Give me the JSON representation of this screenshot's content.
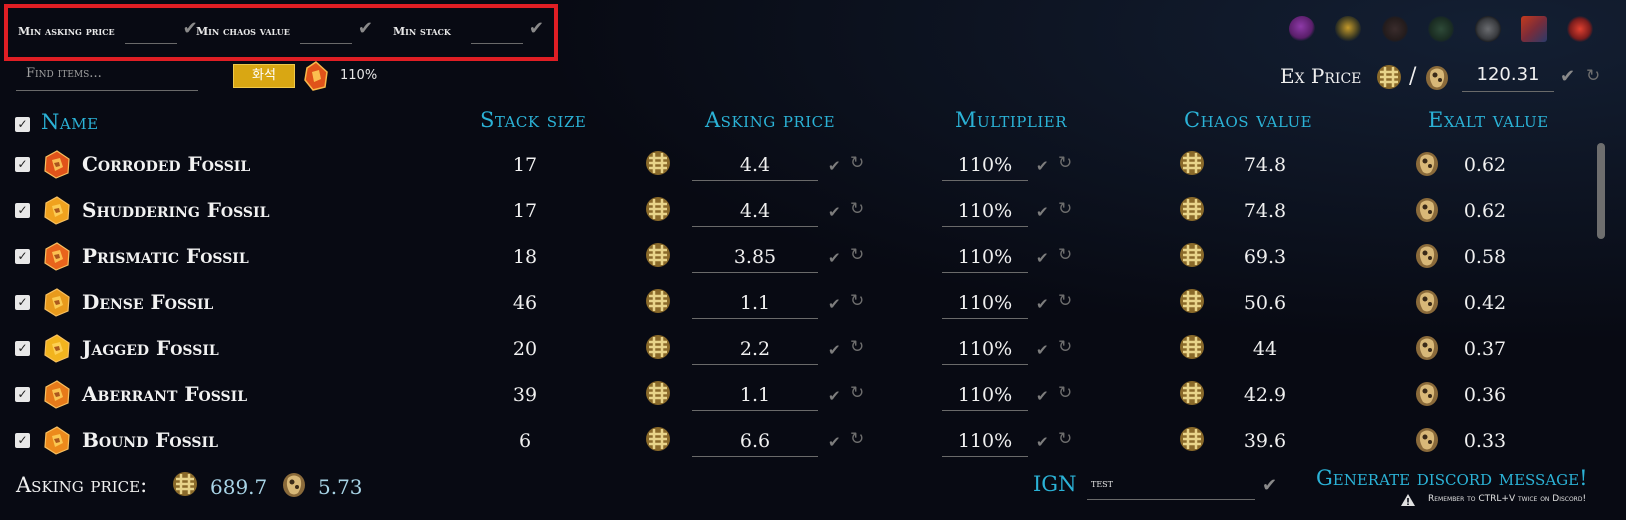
{
  "filters": {
    "min_asking_price": "Min asking price",
    "min_chaos_value": "Min chaos value",
    "min_stack": "Min stack"
  },
  "search": {
    "placeholder": "Find items..."
  },
  "language_button": "화석",
  "top_multiplier": "110%",
  "ex_price": {
    "label": "Ex Price",
    "separator": "/",
    "value": "120.31"
  },
  "table": {
    "headers": {
      "name": "Name",
      "stack_size": "Stack size",
      "asking_price": "Asking price",
      "multiplier": "Multiplier",
      "chaos_value": "Chaos value",
      "exalt_value": "Exalt value"
    },
    "rows": [
      {
        "name": "Corroded Fossil",
        "stack": "17",
        "asking": "4.4",
        "multiplier": "110%",
        "chaos": "74.8",
        "exalt": "0.62",
        "color": "#e0531a"
      },
      {
        "name": "Shuddering Fossil",
        "stack": "17",
        "asking": "4.4",
        "multiplier": "110%",
        "chaos": "74.8",
        "exalt": "0.62",
        "color": "#f0a21e"
      },
      {
        "name": "Prismatic Fossil",
        "stack": "18",
        "asking": "3.85",
        "multiplier": "110%",
        "chaos": "69.3",
        "exalt": "0.58",
        "color": "#e8641c"
      },
      {
        "name": "Dense Fossil",
        "stack": "46",
        "asking": "1.1",
        "multiplier": "110%",
        "chaos": "50.6",
        "exalt": "0.42",
        "color": "#e89a1c"
      },
      {
        "name": "Jagged Fossil",
        "stack": "20",
        "asking": "2.2",
        "multiplier": "110%",
        "chaos": "44",
        "exalt": "0.37",
        "color": "#f2b41e"
      },
      {
        "name": "Aberrant Fossil",
        "stack": "39",
        "asking": "1.1",
        "multiplier": "110%",
        "chaos": "42.9",
        "exalt": "0.36",
        "color": "#e67a1a"
      },
      {
        "name": "Bound Fossil",
        "stack": "6",
        "asking": "6.6",
        "multiplier": "110%",
        "chaos": "39.6",
        "exalt": "0.33",
        "color": "#ec8a1c"
      }
    ]
  },
  "footer": {
    "asking_price_label": "Asking price:",
    "total_chaos": "689.7",
    "total_exalt": "5.73",
    "ign_label": "IGN",
    "ign_value": "test",
    "generate_button": "Generate discord message!",
    "reminder": "Remember to CTRL+V twice on Discord!"
  },
  "icons": {
    "check": "check-icon",
    "refresh": "refresh-icon",
    "chaos": "chaos-orb-icon",
    "exalt": "exalted-orb-icon",
    "warning": "warning-icon"
  },
  "colors": {
    "accent": "#2bb2d6",
    "highlight_border": "#e01e24",
    "language_button": "#d9a713"
  }
}
